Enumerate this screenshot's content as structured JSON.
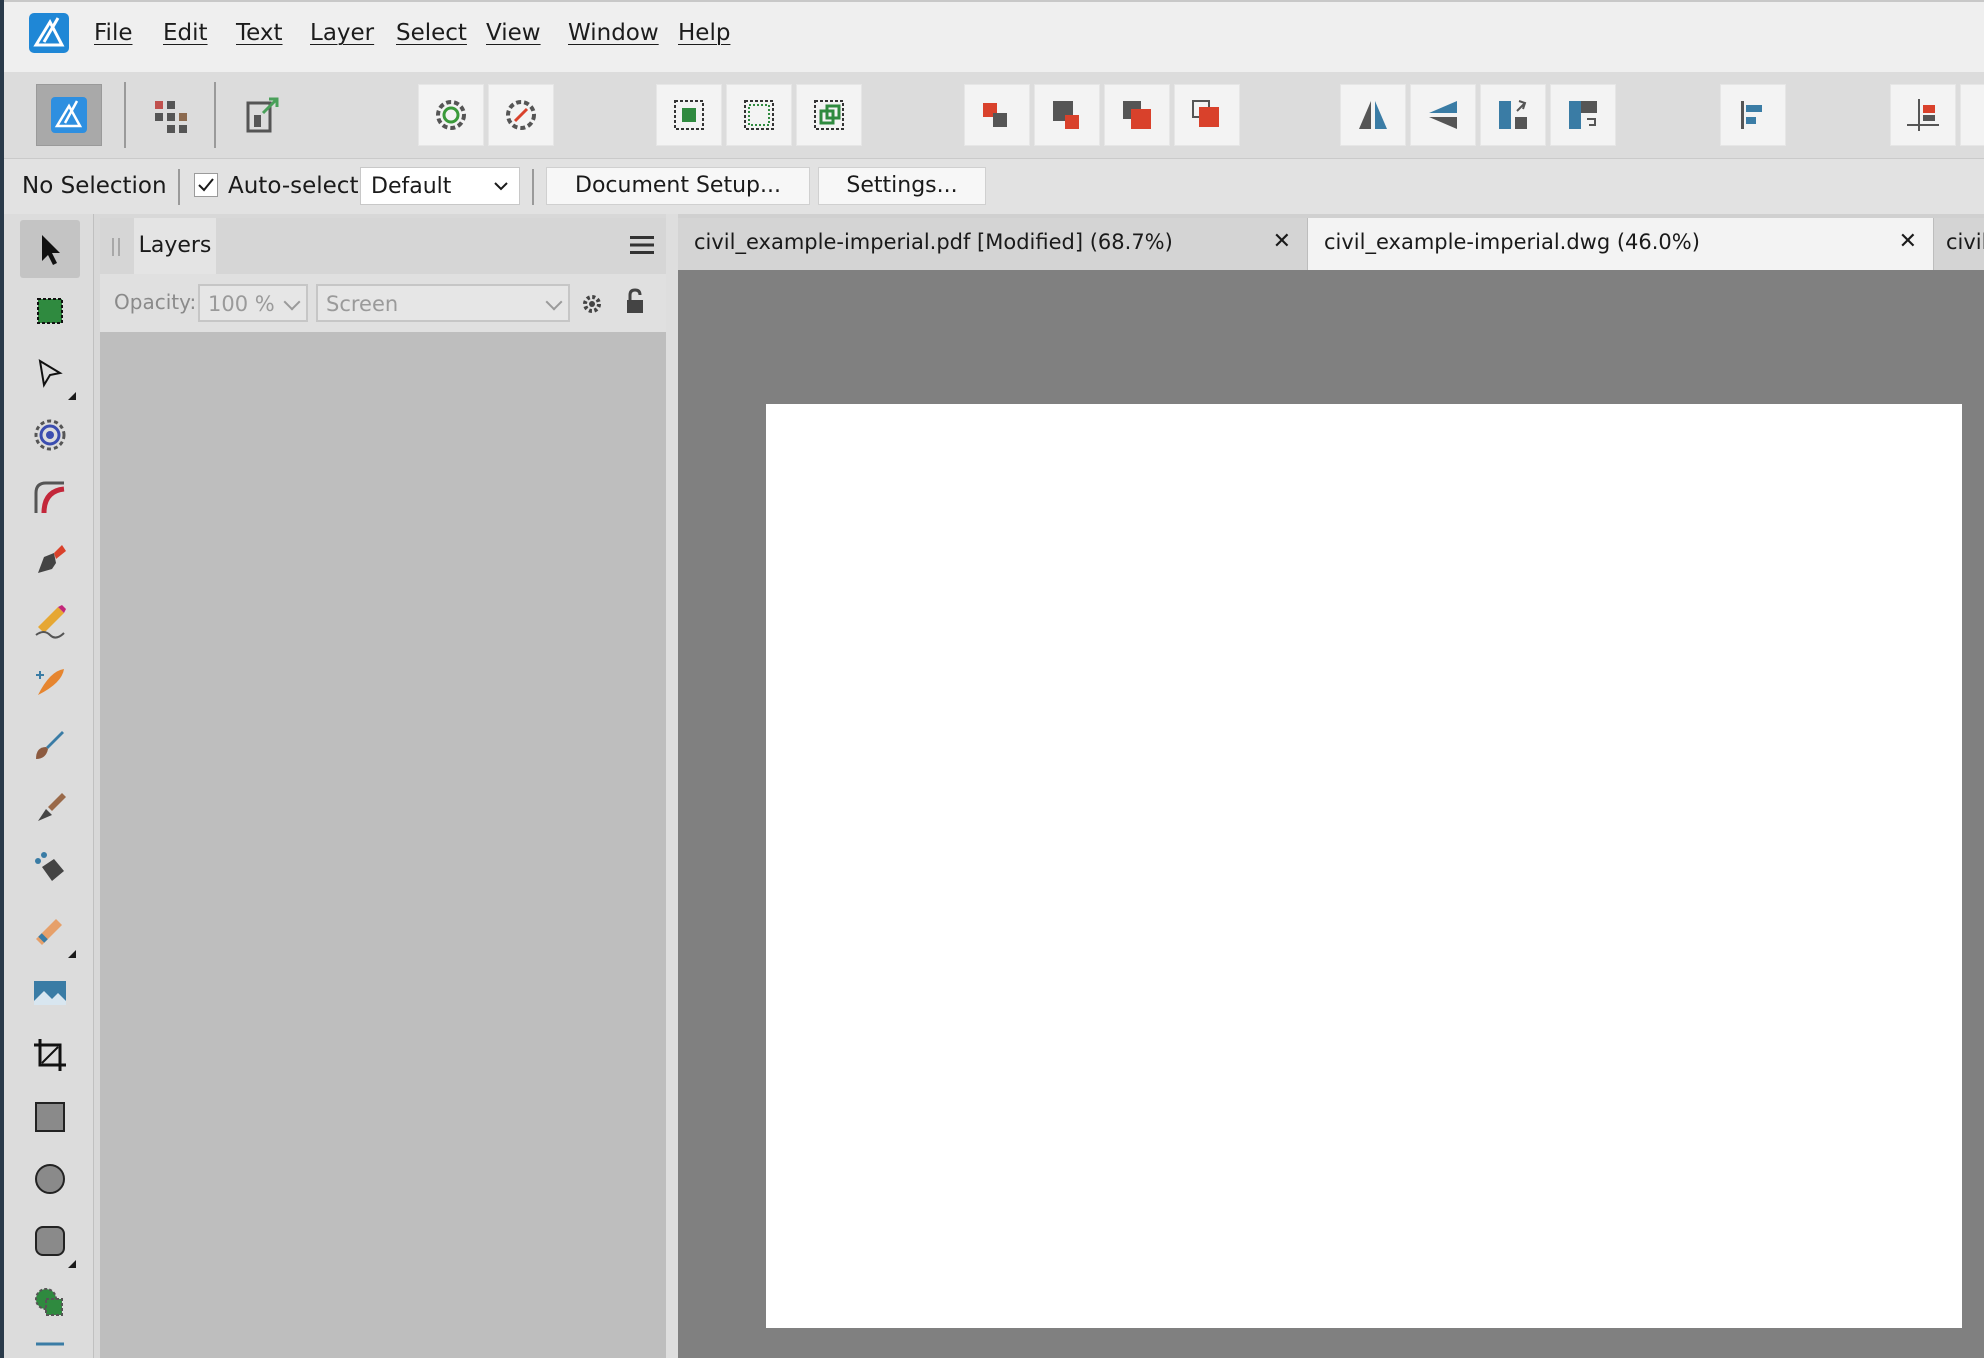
{
  "menubar": {
    "items": [
      "File",
      "Edit",
      "Text",
      "Layer",
      "Select",
      "View",
      "Window",
      "Help"
    ]
  },
  "contextbar": {
    "selection_status": "No Selection",
    "auto_select_label": "Auto-select:",
    "auto_select_checked": true,
    "auto_select_mode": "Default",
    "document_setup_label": "Document Setup...",
    "settings_label": "Settings..."
  },
  "layers_panel": {
    "tab_label": "Layers",
    "opacity_label": "Opacity:",
    "opacity_value": "100 %",
    "blend_mode": "Screen"
  },
  "documents": {
    "tabs": [
      {
        "title": "civil_example-imperial.pdf [Modified] (68.7%)",
        "active": false,
        "close": "✕"
      },
      {
        "title": "civil_example-imperial.dwg (46.0%)",
        "active": true,
        "close": "✕"
      },
      {
        "title": "civil",
        "active": false
      }
    ]
  },
  "colors": {
    "accent": "#1d6fb8",
    "canvas_bg": "#808080",
    "panel_bg": "#bebebe"
  }
}
